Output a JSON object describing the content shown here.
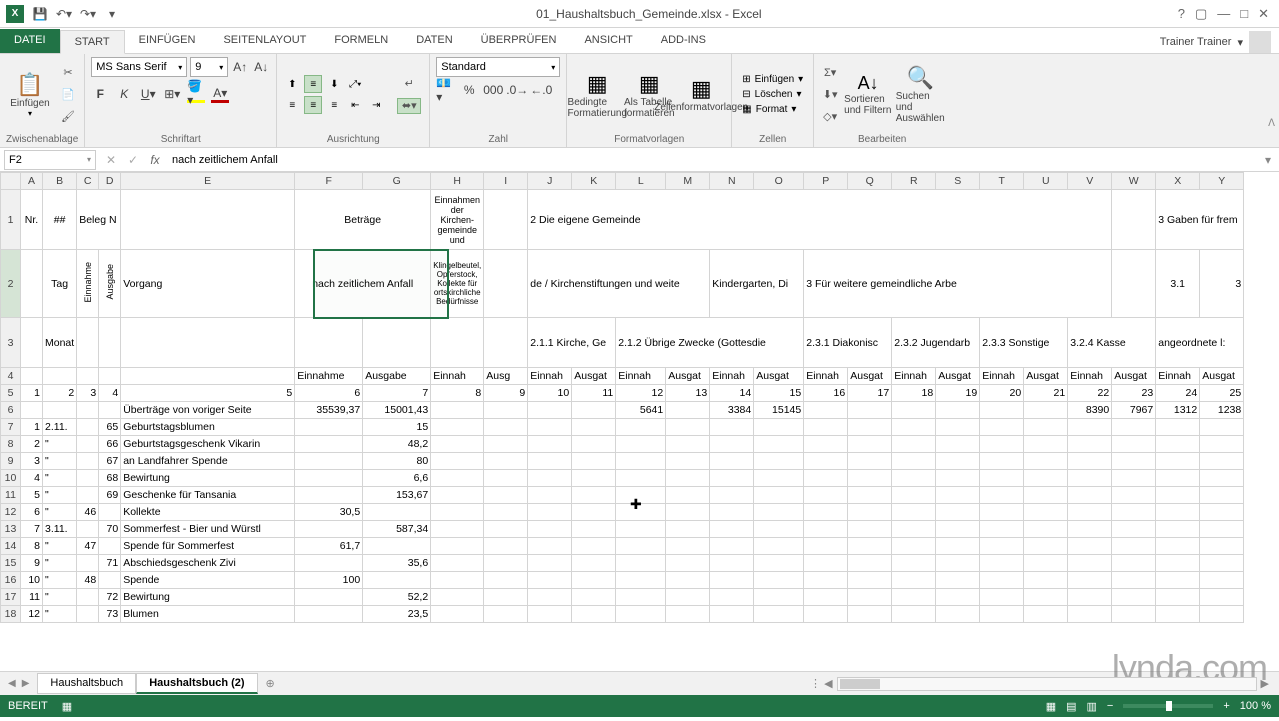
{
  "title": "01_Haushaltsbuch_Gemeinde.xlsx - Excel",
  "account": "Trainer Trainer",
  "tabs": [
    "DATEI",
    "START",
    "EINFÜGEN",
    "SEITENLAYOUT",
    "FORMELN",
    "DATEN",
    "ÜBERPRÜFEN",
    "ANSICHT",
    "ADD-INS"
  ],
  "activeTab": 1,
  "ribbon": {
    "clipboard": {
      "label": "Zwischenablage",
      "paste": "Einfügen"
    },
    "font": {
      "label": "Schriftart",
      "name": "MS Sans Serif",
      "size": "9"
    },
    "align": {
      "label": "Ausrichtung"
    },
    "number": {
      "label": "Zahl",
      "format": "Standard"
    },
    "styles": {
      "label": "Formatvorlagen",
      "cond": "Bedingte Formatierung",
      "table": "Als Tabelle formatieren",
      "cell": "Zellenformatvorlagen"
    },
    "cells": {
      "label": "Zellen",
      "insert": "Einfügen",
      "delete": "Löschen",
      "format": "Format"
    },
    "editing": {
      "label": "Bearbeiten",
      "sort": "Sortieren und Filtern",
      "find": "Suchen und Auswählen"
    }
  },
  "namebox": "F2",
  "formula": "nach zeitlichem Anfall",
  "cols": [
    "A",
    "B",
    "C",
    "D",
    "E",
    "F",
    "G",
    "H",
    "I",
    "J",
    "K",
    "L",
    "M",
    "N",
    "O",
    "P",
    "Q",
    "R",
    "S",
    "T",
    "U",
    "V",
    "W",
    "X",
    "Y"
  ],
  "row1": {
    "A": "Nr.",
    "B": "##",
    "C": "Beleg N",
    "FG": "Beträge",
    "H": "Einnahmen der Kirchen-gemeinde und",
    "J": "2 Die eigene Gemeinde",
    "X": "3 Gaben für frem"
  },
  "row2": {
    "B": "Tag",
    "C": "Einnahme",
    "D": "Ausgabe",
    "E": "Vorgang",
    "FG": "nach zeitlichem Anfall",
    "H": "Klingelbeutel, Opferstock, Kollekte für ortskirchliche Bedürfnisse",
    "J": "de / Kirchenstiftungen und weite",
    "N": "Kindergarten, Di",
    "P": "3 Für weitere gemeindliche Arbe",
    "X": "3.1",
    "Y": "3"
  },
  "row3": {
    "B": "Monat",
    "J": "2.1.1 Kirche, Ge",
    "L": "2.1.2 Übrige Zwecke (Gottesdie",
    "P": "2.3.1 Diakonisc",
    "R": "2.3.2 Jugendarb",
    "T": "2.3.3 Sonstige",
    "V": "3.2.4 Kasse",
    "X": "angeordnete l:"
  },
  "row4": {
    "F": "Einnahme",
    "G": "Ausgabe",
    "H": "Einnah",
    "I": "Ausg",
    "J": "Einnah",
    "K": "Ausgat",
    "L": "Einnah",
    "M": "Ausgat",
    "N": "Einnah",
    "O": "Ausgat",
    "P": "Einnah",
    "Q": "Ausgat",
    "R": "Einnah",
    "S": "Ausgat",
    "T": "Einnah",
    "U": "Ausgat",
    "V": "Einnah",
    "W": "Ausgat",
    "X": "Einnah",
    "Y": "Ausgat"
  },
  "row5": [
    "1",
    "2",
    "3",
    "4",
    "5",
    "6",
    "7",
    "8",
    "9",
    "10",
    "11",
    "12",
    "13",
    "14",
    "15",
    "16",
    "17",
    "18",
    "19",
    "20",
    "21",
    "22",
    "23",
    "24",
    "25"
  ],
  "dataRows": [
    {
      "r": 6,
      "E": "Überträge von voriger Seite",
      "F": "35539,37",
      "G": "15001,43",
      "L": "5641",
      "N": "3384",
      "O": "15145",
      "V": "8390",
      "W": "7967",
      "X": "1312",
      "Y": "1238"
    },
    {
      "r": 7,
      "A": "1",
      "B": "2.11.",
      "D": "65",
      "E": "Geburtstagsblumen",
      "G": "15"
    },
    {
      "r": 8,
      "A": "2",
      "B": "\"",
      "D": "66",
      "E": "Geburtstagsgeschenk Vikarin",
      "G": "48,2"
    },
    {
      "r": 9,
      "A": "3",
      "B": "\"",
      "D": "67",
      "E": "an Landfahrer Spende",
      "G": "80"
    },
    {
      "r": 10,
      "A": "4",
      "B": "\"",
      "D": "68",
      "E": "Bewirtung",
      "G": "6,6"
    },
    {
      "r": 11,
      "A": "5",
      "B": "\"",
      "D": "69",
      "E": "Geschenke für Tansania",
      "G": "153,67"
    },
    {
      "r": 12,
      "A": "6",
      "B": "\"",
      "C": "46",
      "E": "Kollekte",
      "F": "30,5"
    },
    {
      "r": 13,
      "A": "7",
      "B": "3.11.",
      "D": "70",
      "E": "Sommerfest - Bier und Würstl",
      "G": "587,34"
    },
    {
      "r": 14,
      "A": "8",
      "B": "\"",
      "C": "47",
      "E": "Spende für Sommerfest",
      "F": "61,7"
    },
    {
      "r": 15,
      "A": "9",
      "B": "\"",
      "D": "71",
      "E": "Abschiedsgeschenk Zivi",
      "G": "35,6"
    },
    {
      "r": 16,
      "A": "10",
      "B": "\"",
      "C": "48",
      "E": "Spende",
      "F": "100"
    },
    {
      "r": 17,
      "A": "11",
      "B": "\"",
      "D": "72",
      "E": "Bewirtung",
      "G": "52,2"
    },
    {
      "r": 18,
      "A": "12",
      "B": "\"",
      "D": "73",
      "E": "Blumen",
      "G": "23,5"
    }
  ],
  "sheets": [
    "Haushaltsbuch",
    "Haushaltsbuch (2)"
  ],
  "activeSheet": 1,
  "status": "BEREIT",
  "zoom": "100 %",
  "watermark": "lynda.com"
}
